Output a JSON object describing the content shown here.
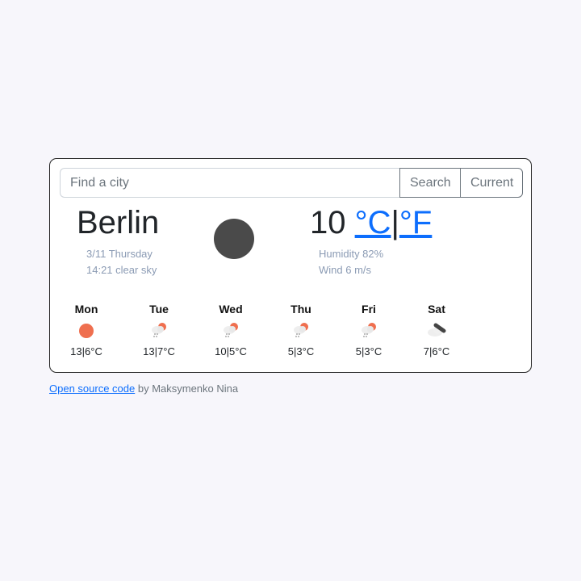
{
  "search": {
    "placeholder": "Find a city",
    "value": "",
    "search_label": "Search",
    "current_label": "Current"
  },
  "current": {
    "city": "Berlin",
    "date": "3/11 Thursday",
    "description": "14:21 clear sky",
    "icon": "clear-sky-icon",
    "temperature": "10",
    "unit_c": "°C",
    "unit_sep": "|",
    "unit_f": "°F",
    "humidity": "Humidity 82%",
    "wind": "Wind 6 m/s"
  },
  "forecast": [
    {
      "day": "Mon",
      "icon": "sun-icon",
      "temp": "13|6°C"
    },
    {
      "day": "Tue",
      "icon": "rain-sun-cloud-icon",
      "temp": "13|7°C"
    },
    {
      "day": "Wed",
      "icon": "rain-sun-cloud-icon",
      "temp": "10|5°C"
    },
    {
      "day": "Thu",
      "icon": "rain-sun-cloud-icon",
      "temp": "5|3°C"
    },
    {
      "day": "Fri",
      "icon": "rain-sun-cloud-icon",
      "temp": "5|3°C"
    },
    {
      "day": "Sat",
      "icon": "broken-clouds-icon",
      "temp": "7|6°C"
    }
  ],
  "footer": {
    "link": "Open source code",
    "text": " by Maksymenko Nina"
  },
  "colors": {
    "accent": "#0d6efd",
    "sun": "#ef6f4f",
    "muted": "#8b9bb4"
  }
}
